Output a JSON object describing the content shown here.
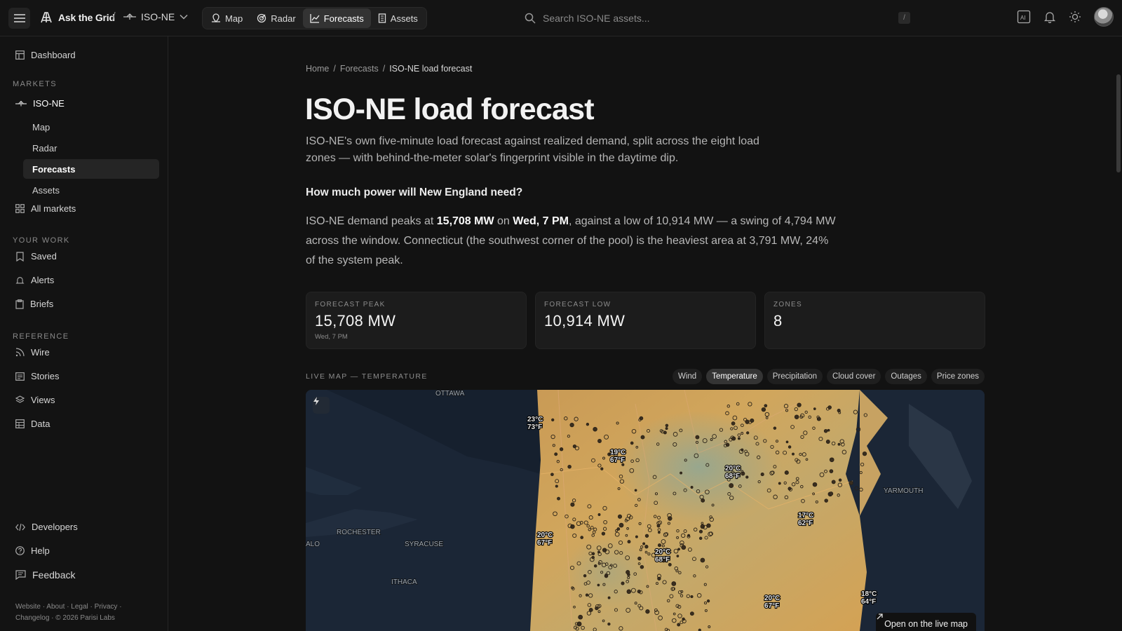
{
  "brand": {
    "name": "Ask the Grid"
  },
  "market_switch": {
    "label": "ISO-NE"
  },
  "nav": [
    {
      "label": "Map",
      "icon": "map-icon"
    },
    {
      "label": "Radar",
      "icon": "radar-icon"
    },
    {
      "label": "Forecasts",
      "icon": "chart-icon",
      "active": true
    },
    {
      "label": "Assets",
      "icon": "building-icon"
    }
  ],
  "search": {
    "placeholder": "Search ISO-NE assets...",
    "shortcut": "/"
  },
  "sidebar": {
    "dashboard": "Dashboard",
    "markets_heading": "MARKETS",
    "market": "ISO-NE",
    "market_sub": [
      "Map",
      "Radar",
      "Forecasts",
      "Assets"
    ],
    "all_markets": "All markets",
    "your_work_heading": "YOUR WORK",
    "saved": "Saved",
    "alerts": "Alerts",
    "briefs": "Briefs",
    "reference_heading": "REFERENCE",
    "wire": "Wire",
    "stories": "Stories",
    "views": "Views",
    "data": "Data",
    "developers": "Developers",
    "help": "Help",
    "feedback": "Feedback",
    "footer_line1": "Website · About · Legal · Privacy ·",
    "footer_line2": "Changelog · © 2026 Parisi Labs"
  },
  "breadcrumb": {
    "home": "Home",
    "section": "Forecasts",
    "current": "ISO-NE load forecast"
  },
  "page": {
    "title": "ISO-NE load forecast",
    "lede": "ISO-NE's own five-minute load forecast against realized demand, split across the eight load zones — with behind-the-meter solar's fingerprint visible in the daytime dip.",
    "question": "How much power will New England need?",
    "summary_pre": "ISO-NE demand peaks at ",
    "summary_peak": "15,708 MW",
    "summary_on": " on ",
    "summary_time": "Wed, 7 PM",
    "summary_post": ", against a low of 10,914 MW — a swing of 4,794 MW across the window. Connecticut (the southwest corner of the pool) is the heaviest area at 3,791 MW, 24% of the system peak."
  },
  "stats": [
    {
      "label": "FORECAST PEAK",
      "value": "15,708 MW",
      "sub": "Wed, 7 PM"
    },
    {
      "label": "FORECAST LOW",
      "value": "10,914 MW",
      "sub": ""
    },
    {
      "label": "ZONES",
      "value": "8",
      "sub": ""
    }
  ],
  "live_map": {
    "label": "LIVE MAP — TEMPERATURE",
    "layers": [
      "Wind",
      "Temperature",
      "Precipitation",
      "Cloud cover",
      "Outages",
      "Price zones"
    ],
    "active_layer": "Temperature",
    "open_button": "Open on the live map",
    "cities": [
      "OTTAWA",
      "ROCHESTER",
      "SYRACUSE",
      "ITHACA",
      "YARMOUTH",
      "ALO"
    ],
    "temps": [
      {
        "c": "23°C",
        "f": "73°F"
      },
      {
        "c": "19°C",
        "f": "67°F"
      },
      {
        "c": "20°C",
        "f": "68°F"
      },
      {
        "c": "17°C",
        "f": "62°F"
      },
      {
        "c": "20°C",
        "f": "67°F"
      },
      {
        "c": "20°C",
        "f": "68°F"
      },
      {
        "c": "20°C",
        "f": "67°F"
      },
      {
        "c": "18°C",
        "f": "64°F"
      }
    ]
  }
}
